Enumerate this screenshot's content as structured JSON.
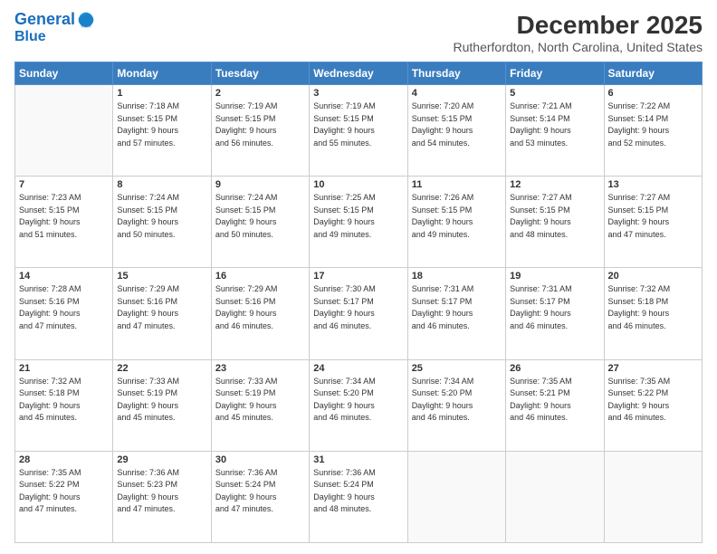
{
  "logo": {
    "line1": "General",
    "line2": "Blue"
  },
  "title": "December 2025",
  "location": "Rutherfordton, North Carolina, United States",
  "weekdays": [
    "Sunday",
    "Monday",
    "Tuesday",
    "Wednesday",
    "Thursday",
    "Friday",
    "Saturday"
  ],
  "weeks": [
    [
      {
        "day": "",
        "info": ""
      },
      {
        "day": "1",
        "info": "Sunrise: 7:18 AM\nSunset: 5:15 PM\nDaylight: 9 hours\nand 57 minutes."
      },
      {
        "day": "2",
        "info": "Sunrise: 7:19 AM\nSunset: 5:15 PM\nDaylight: 9 hours\nand 56 minutes."
      },
      {
        "day": "3",
        "info": "Sunrise: 7:19 AM\nSunset: 5:15 PM\nDaylight: 9 hours\nand 55 minutes."
      },
      {
        "day": "4",
        "info": "Sunrise: 7:20 AM\nSunset: 5:15 PM\nDaylight: 9 hours\nand 54 minutes."
      },
      {
        "day": "5",
        "info": "Sunrise: 7:21 AM\nSunset: 5:14 PM\nDaylight: 9 hours\nand 53 minutes."
      },
      {
        "day": "6",
        "info": "Sunrise: 7:22 AM\nSunset: 5:14 PM\nDaylight: 9 hours\nand 52 minutes."
      }
    ],
    [
      {
        "day": "7",
        "info": "Sunrise: 7:23 AM\nSunset: 5:15 PM\nDaylight: 9 hours\nand 51 minutes."
      },
      {
        "day": "8",
        "info": "Sunrise: 7:24 AM\nSunset: 5:15 PM\nDaylight: 9 hours\nand 50 minutes."
      },
      {
        "day": "9",
        "info": "Sunrise: 7:24 AM\nSunset: 5:15 PM\nDaylight: 9 hours\nand 50 minutes."
      },
      {
        "day": "10",
        "info": "Sunrise: 7:25 AM\nSunset: 5:15 PM\nDaylight: 9 hours\nand 49 minutes."
      },
      {
        "day": "11",
        "info": "Sunrise: 7:26 AM\nSunset: 5:15 PM\nDaylight: 9 hours\nand 49 minutes."
      },
      {
        "day": "12",
        "info": "Sunrise: 7:27 AM\nSunset: 5:15 PM\nDaylight: 9 hours\nand 48 minutes."
      },
      {
        "day": "13",
        "info": "Sunrise: 7:27 AM\nSunset: 5:15 PM\nDaylight: 9 hours\nand 47 minutes."
      }
    ],
    [
      {
        "day": "14",
        "info": "Sunrise: 7:28 AM\nSunset: 5:16 PM\nDaylight: 9 hours\nand 47 minutes."
      },
      {
        "day": "15",
        "info": "Sunrise: 7:29 AM\nSunset: 5:16 PM\nDaylight: 9 hours\nand 47 minutes."
      },
      {
        "day": "16",
        "info": "Sunrise: 7:29 AM\nSunset: 5:16 PM\nDaylight: 9 hours\nand 46 minutes."
      },
      {
        "day": "17",
        "info": "Sunrise: 7:30 AM\nSunset: 5:17 PM\nDaylight: 9 hours\nand 46 minutes."
      },
      {
        "day": "18",
        "info": "Sunrise: 7:31 AM\nSunset: 5:17 PM\nDaylight: 9 hours\nand 46 minutes."
      },
      {
        "day": "19",
        "info": "Sunrise: 7:31 AM\nSunset: 5:17 PM\nDaylight: 9 hours\nand 46 minutes."
      },
      {
        "day": "20",
        "info": "Sunrise: 7:32 AM\nSunset: 5:18 PM\nDaylight: 9 hours\nand 46 minutes."
      }
    ],
    [
      {
        "day": "21",
        "info": "Sunrise: 7:32 AM\nSunset: 5:18 PM\nDaylight: 9 hours\nand 45 minutes."
      },
      {
        "day": "22",
        "info": "Sunrise: 7:33 AM\nSunset: 5:19 PM\nDaylight: 9 hours\nand 45 minutes."
      },
      {
        "day": "23",
        "info": "Sunrise: 7:33 AM\nSunset: 5:19 PM\nDaylight: 9 hours\nand 45 minutes."
      },
      {
        "day": "24",
        "info": "Sunrise: 7:34 AM\nSunset: 5:20 PM\nDaylight: 9 hours\nand 46 minutes."
      },
      {
        "day": "25",
        "info": "Sunrise: 7:34 AM\nSunset: 5:20 PM\nDaylight: 9 hours\nand 46 minutes."
      },
      {
        "day": "26",
        "info": "Sunrise: 7:35 AM\nSunset: 5:21 PM\nDaylight: 9 hours\nand 46 minutes."
      },
      {
        "day": "27",
        "info": "Sunrise: 7:35 AM\nSunset: 5:22 PM\nDaylight: 9 hours\nand 46 minutes."
      }
    ],
    [
      {
        "day": "28",
        "info": "Sunrise: 7:35 AM\nSunset: 5:22 PM\nDaylight: 9 hours\nand 47 minutes."
      },
      {
        "day": "29",
        "info": "Sunrise: 7:36 AM\nSunset: 5:23 PM\nDaylight: 9 hours\nand 47 minutes."
      },
      {
        "day": "30",
        "info": "Sunrise: 7:36 AM\nSunset: 5:24 PM\nDaylight: 9 hours\nand 47 minutes."
      },
      {
        "day": "31",
        "info": "Sunrise: 7:36 AM\nSunset: 5:24 PM\nDaylight: 9 hours\nand 48 minutes."
      },
      {
        "day": "",
        "info": ""
      },
      {
        "day": "",
        "info": ""
      },
      {
        "day": "",
        "info": ""
      }
    ]
  ]
}
